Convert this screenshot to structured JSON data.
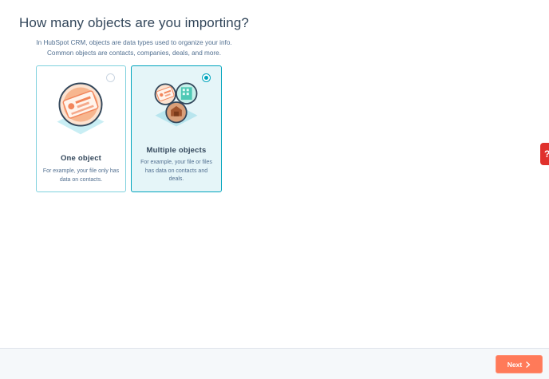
{
  "page": {
    "title": "How many objects are you importing?",
    "subtitle_line1": "In HubSpot CRM, objects are data types used to organize your info.",
    "subtitle_line2": "Common objects are contacts, companies, deals, and more."
  },
  "options": [
    {
      "title": "One object",
      "description": "For example, your file only has data on contacts.",
      "selected": false
    },
    {
      "title": "Multiple objects",
      "description": "For example, your file or files has data on contacts and deals.",
      "selected": true
    }
  ],
  "footer": {
    "next_label": "Next"
  },
  "help_widget": {
    "glyph": "?"
  },
  "colors": {
    "accent": "#00a4bd",
    "primary_button": "#ff7a59",
    "selected_card_bg": "#e5f5f8",
    "text": "#33475b"
  }
}
